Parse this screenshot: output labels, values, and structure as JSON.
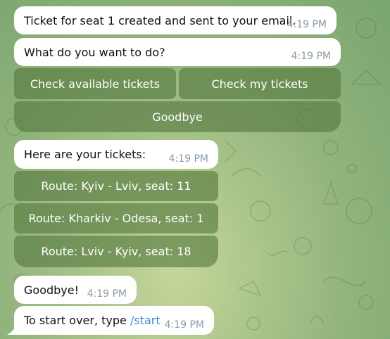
{
  "messages": {
    "m1": {
      "text": "Ticket for seat 1 created and sent to your email.",
      "time": "4:19 PM"
    },
    "m2": {
      "text": "What do you want to do?",
      "time": "4:19 PM"
    },
    "m3": {
      "text": "Here are your tickets:",
      "time": "4:19 PM"
    },
    "m4": {
      "text": "Goodbye!",
      "time": "4:19 PM"
    },
    "m5": {
      "text_prefix": "To start over, type ",
      "command": "/start",
      "time": "4:19 PM"
    }
  },
  "menu_buttons": {
    "check_available": "Check available tickets",
    "check_my": "Check my tickets",
    "goodbye": "Goodbye"
  },
  "ticket_buttons": [
    "Route: Kyiv - Lviv, seat: 11",
    "Route: Kharkiv - Odesa, seat: 1",
    "Route: Lviv - Kyiv, seat: 18"
  ],
  "colors": {
    "bubble": "#ffffff",
    "timestamp": "#8a9aa6",
    "link": "#3a8fd1",
    "inline_button": "#54783e"
  }
}
